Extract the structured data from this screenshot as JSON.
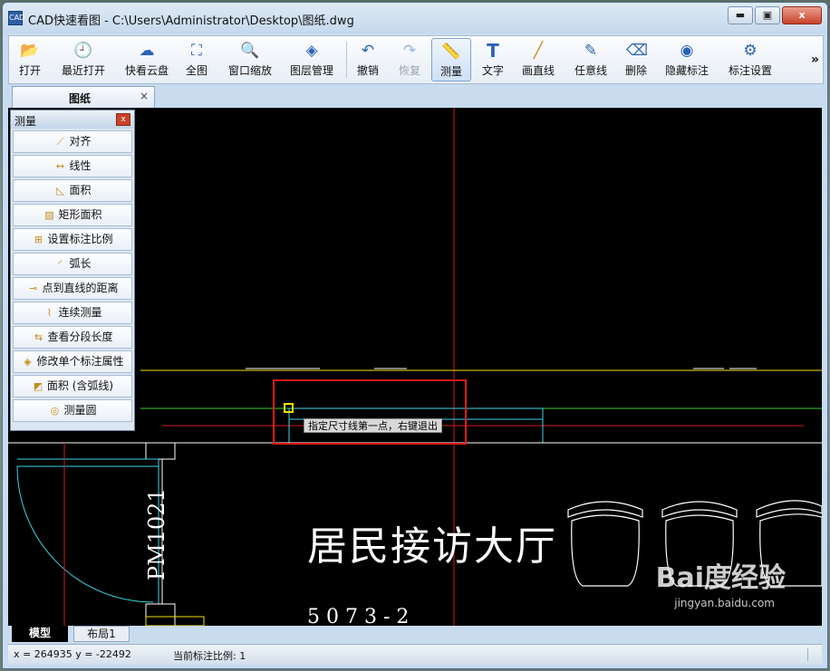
{
  "window": {
    "title": "CAD快速看图 - C:\\Users\\Administrator\\Desktop\\图纸.dwg",
    "app_icon": "cad-app-icon",
    "controls": {
      "minimize": "▬",
      "maximize": "▣",
      "close": "x"
    }
  },
  "toolbar": {
    "items": [
      {
        "label": "打开",
        "icon": "folder-open-icon",
        "glyph": "📂"
      },
      {
        "label": "最近打开",
        "icon": "clock-history-icon",
        "glyph": "🕘"
      },
      {
        "label": "快看云盘",
        "icon": "cloud-icon",
        "glyph": "☁"
      },
      {
        "label": "全图",
        "icon": "fit-all-icon",
        "glyph": "⛶"
      },
      {
        "label": "窗口缩放",
        "icon": "zoom-window-icon",
        "glyph": "🔍"
      },
      {
        "label": "图层管理",
        "icon": "layers-icon",
        "glyph": "◈"
      },
      {
        "label": "撤销",
        "icon": "undo-icon",
        "glyph": "↶"
      },
      {
        "label": "恢复",
        "icon": "redo-icon",
        "glyph": "↷"
      },
      {
        "label": "测量",
        "icon": "ruler-icon",
        "glyph": "📏"
      },
      {
        "label": "文字",
        "icon": "text-icon",
        "glyph": "T"
      },
      {
        "label": "画直线",
        "icon": "line-icon",
        "glyph": "╱"
      },
      {
        "label": "任意线",
        "icon": "pen-icon",
        "glyph": "✎"
      },
      {
        "label": "删除",
        "icon": "eraser-icon",
        "glyph": "⌫"
      },
      {
        "label": "隐藏标注",
        "icon": "hide-eye-icon",
        "glyph": "◉"
      },
      {
        "label": "标注设置",
        "icon": "annotation-settings-icon",
        "glyph": "⚙"
      }
    ],
    "more": "»"
  },
  "doc_tab": {
    "label": "图纸",
    "close": "×"
  },
  "measure_panel": {
    "title": "测量",
    "close": "x",
    "items": [
      {
        "label": "对齐",
        "icon": "align-measure-icon"
      },
      {
        "label": "线性",
        "icon": "linear-measure-icon"
      },
      {
        "label": "面积",
        "icon": "area-icon"
      },
      {
        "label": "矩形面积",
        "icon": "rect-area-icon"
      },
      {
        "label": "设置标注比例",
        "icon": "scale-icon"
      },
      {
        "label": "弧长",
        "icon": "arc-length-icon"
      },
      {
        "label": "点到直线的距离",
        "icon": "point-line-distance-icon"
      },
      {
        "label": "连续测量",
        "icon": "continuous-measure-icon"
      },
      {
        "label": "查看分段长度",
        "icon": "segment-length-icon"
      },
      {
        "label": "修改单个标注属性",
        "icon": "edit-annotation-icon"
      },
      {
        "label": "面积 (含弧线)",
        "icon": "arc-area-icon"
      },
      {
        "label": "测量圆",
        "icon": "circle-measure-icon"
      }
    ]
  },
  "canvas": {
    "prompt": "指定尺寸线第一点，右键退出",
    "hall_label": "居民接访大厅",
    "door_label": "PM1021",
    "partial_label": "5 0 7 3 - 2",
    "colors": {
      "background": "#000000",
      "cyan": "#3cd4e6",
      "red": "#d11d1d",
      "green": "#2fd12f",
      "yellow": "#f4e000",
      "white": "#ffffff",
      "highlight": "#e21b1b"
    }
  },
  "layout_tabs": [
    {
      "label": "模型",
      "active": true
    },
    {
      "label": "布局1",
      "active": false
    }
  ],
  "status": {
    "coords": "x = 264935 y = -22492",
    "scale": "当前标注比例: 1"
  },
  "watermark": {
    "brand": "Bai度经验",
    "url": "jingyan.baidu.com"
  }
}
